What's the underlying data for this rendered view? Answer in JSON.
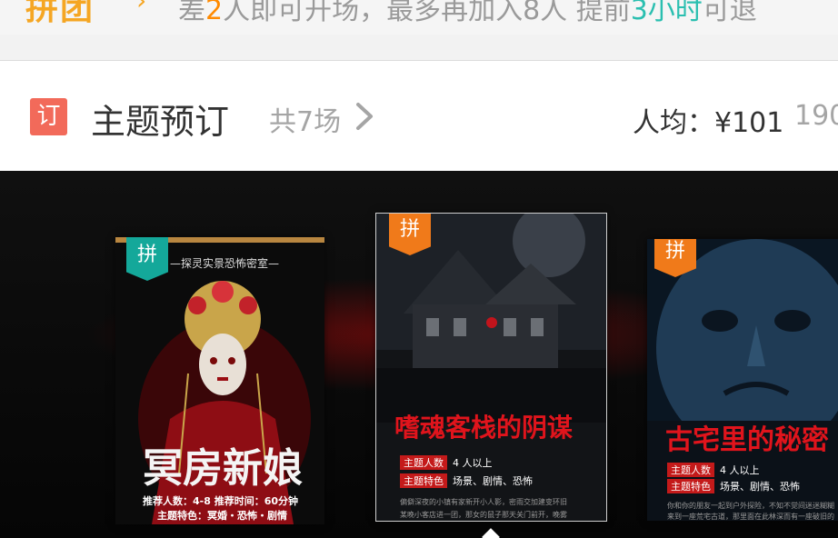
{
  "promo": {
    "logo": "拼团",
    "text_prefix": "差",
    "need_count": "2",
    "text_mid": "人即可开场，最多再加入8人 提前",
    "refund_hours": "3小时",
    "text_suffix": "可退"
  },
  "header": {
    "badge": "订",
    "title": "主题预订",
    "count": "共7场",
    "avg_price": "人均：¥101",
    "next_price": "190"
  },
  "posters": [
    {
      "tag": "拼",
      "subtitle": "—探灵实景恐怖密室—",
      "title": "冥房新娘",
      "line1": "推荐人数：4-8   推荐时间：60分钟",
      "line2": "主题特色：冥婚・恐怖・剧情"
    },
    {
      "tag": "拼",
      "title": "嗜魂客栈的阴谋",
      "label1": "主题人数",
      "value1": "4 人以上",
      "label2": "主题特色",
      "value2": "场景、剧情、恐怖",
      "desc1": "偏僻深夜的小镇有家新开小人影，密雨交加建变环旧",
      "desc2": "某晚小客店进一团，那女的鼠子那天关门前开，晚雾"
    },
    {
      "tag": "拼",
      "title": "古宅里的秘密",
      "label1": "主题人数",
      "value1": "4 人以上",
      "label2": "主题特色",
      "value2": "场景、剧情、恐怖",
      "desc1": "你和你的朋友一起到户外探险，不知不觉间迷迷糊糊",
      "desc2": "来到一座荒宅古道，那里面在此林深而有一座破旧的"
    }
  ],
  "colors": {
    "accent_orange": "#ff8a00",
    "teal": "#2bbfb0",
    "badge_red": "#f26a5a"
  }
}
